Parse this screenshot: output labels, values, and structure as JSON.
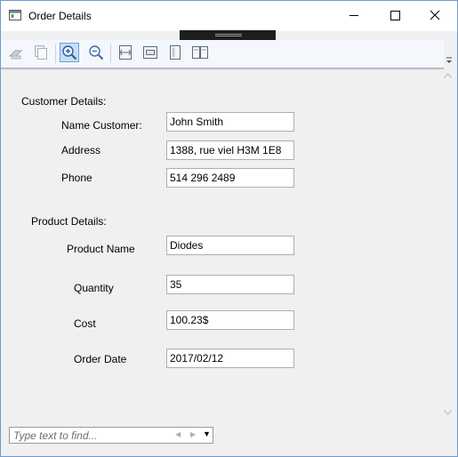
{
  "window": {
    "title": "Order Details",
    "icon": "form-window-icon",
    "accent": "#6f9ad0"
  },
  "toolbar": {
    "buttons": [
      {
        "icon": "print-icon"
      },
      {
        "icon": "copy-icon"
      },
      {
        "icon": "zoom-in-icon"
      },
      {
        "icon": "zoom-out-icon"
      },
      {
        "icon": "page-width-icon"
      },
      {
        "icon": "fit-page-icon"
      },
      {
        "icon": "single-page-icon"
      },
      {
        "icon": "two-pages-icon"
      }
    ]
  },
  "customer": {
    "heading": "Customer Details:",
    "name_label": "Name Customer:",
    "name_value": "John Smith",
    "address_label": "Address",
    "address_value": "1388, rue viel H3M 1E8",
    "phone_label": "Phone",
    "phone_value": "514 296 2489"
  },
  "product": {
    "heading": "Product Details:",
    "name_label": "Product Name",
    "name_value": "Diodes",
    "quantity_label": "Quantity",
    "quantity_value": "35",
    "cost_label": "Cost",
    "cost_value": "100.23$",
    "date_label": "Order Date",
    "date_value": "2017/02/12"
  },
  "find": {
    "placeholder": "Type text to find..."
  }
}
